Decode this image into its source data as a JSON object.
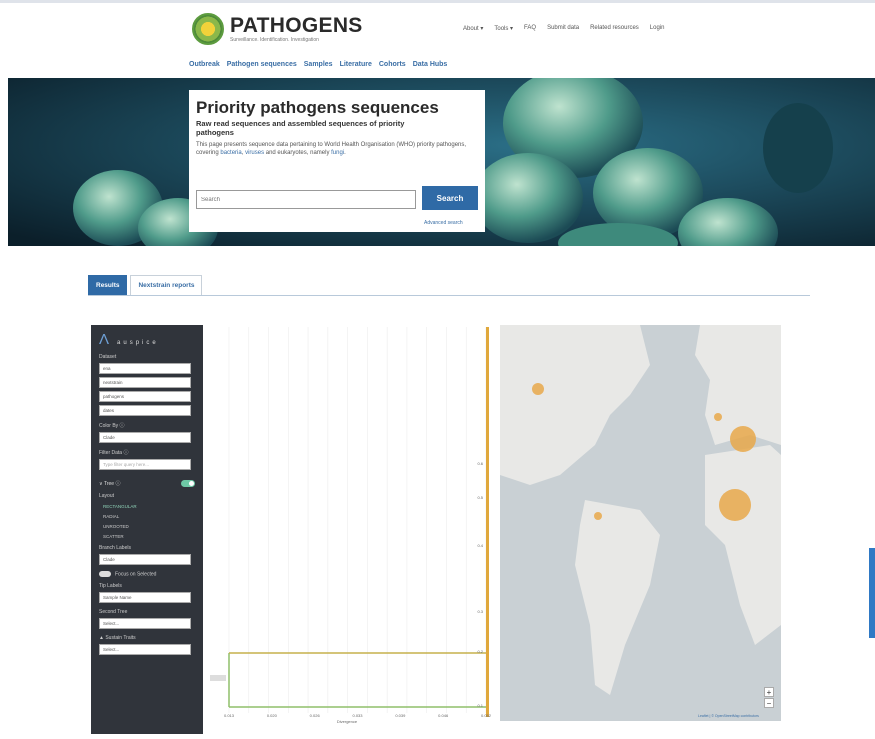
{
  "header": {
    "brand": "PATHOGENS",
    "tagline": "Surveillance. Identification. Investigation",
    "topnav": [
      "About ▾",
      "Tools ▾",
      "FAQ",
      "Submit data",
      "Related resources",
      "Login"
    ],
    "subnav": [
      "Outbreak",
      "Pathogen sequences",
      "Samples",
      "Literature",
      "Cohorts",
      "Data Hubs"
    ]
  },
  "hero": {
    "title": "Priority pathogens sequences",
    "subtitle": "Raw read sequences and assembled sequences of priority pathogens",
    "desc_before": "This page presents sequence data pertaining to World Health Organisation (WHO) priority pathogens, covering ",
    "link_bacteria": "bacteria",
    "desc_comma": ", ",
    "link_viruses": "viruses",
    "desc_middle": " and eukaryotes, namely ",
    "link_fungi": "fungi",
    "desc_end": ".",
    "search_placeholder": "Search",
    "search_button": "Search",
    "advanced_search": "Advanced search"
  },
  "tabs": [
    "Results",
    "Nextstrain reports"
  ],
  "sidebar": {
    "logo_text": "auspice",
    "dataset_label": "Dataset",
    "dataset_selects": [
      "ena",
      "nextstrain",
      "pathogens",
      "dates"
    ],
    "color_by_label": "Color By ⓘ",
    "color_by_value": "Clade",
    "filter_label": "Filter Data ⓘ",
    "filter_placeholder": "Type filter query here...",
    "tree_label": "∨ Tree ⓘ",
    "layout_label": "Layout",
    "layouts": [
      "RECTANGULAR",
      "RADIAL",
      "UNROOTED",
      "SCATTER"
    ],
    "branch_label_heading": "Branch Labels",
    "branch_label_value": "Clade",
    "focus_label": "Focus on Selected",
    "tip_label_heading": "Tip Labels",
    "tip_label_value": "Sample Name",
    "second_tree_label": "Second Tree",
    "second_tree_value": "Select...",
    "sustain_label": "▲ Sustain Traits",
    "sustain_value": "Select..."
  },
  "tree": {
    "x_ticks": [
      "0.013",
      "0.020",
      "0.026",
      "0.033",
      "0.039",
      "0.046",
      "0.052"
    ],
    "x_label": "Divergence",
    "right_labels": [
      "0.6",
      "0.5",
      "0.4",
      "0.3",
      "0.2",
      "0.1"
    ]
  },
  "map": {
    "zoom_in": "+",
    "zoom_out": "−",
    "attribution": "Leaflet | © OpenStreetMap contributors"
  },
  "colors": {
    "accent": "#2f6aa6",
    "tree_line": "#e0a83c",
    "tree_branch": "#8fbf6a",
    "map_bubble": "#e8a84a"
  }
}
